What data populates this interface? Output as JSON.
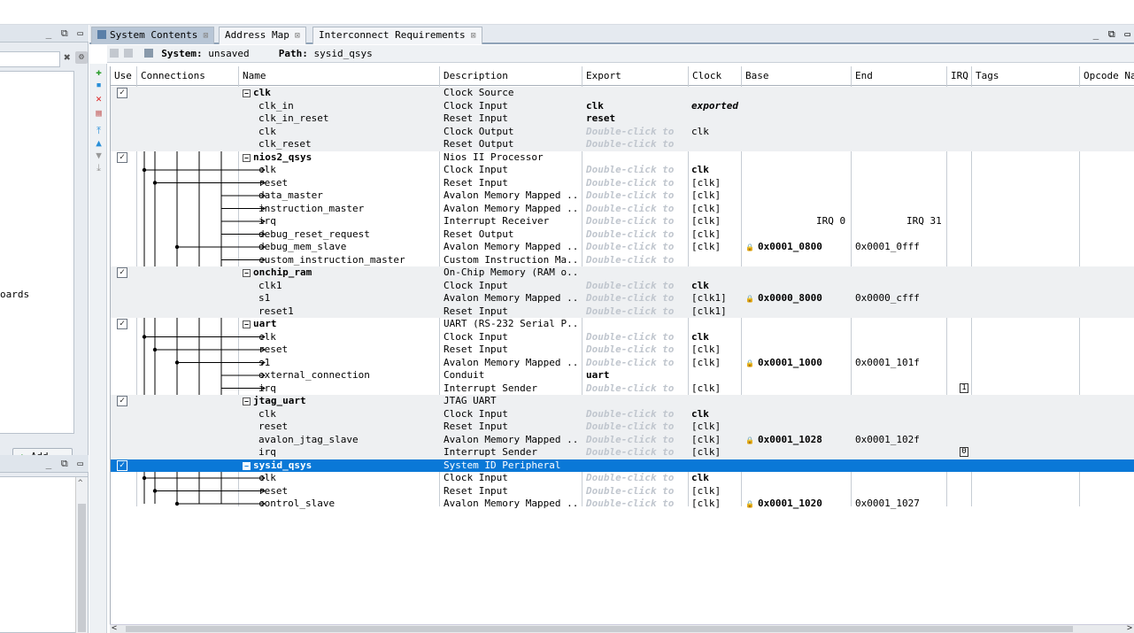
{
  "left_panel": {
    "window_buttons": "_ ⧉ ▭",
    "search_clear": "✖",
    "boards_text": "oards",
    "add_button": "Add...",
    "panel2_window_buttons": "_ ⧉ ▭"
  },
  "tabs": [
    {
      "label": "System Contents",
      "close": "⊠",
      "active": true
    },
    {
      "label": "Address Map",
      "close": "⊠",
      "active": false
    },
    {
      "label": "Interconnect Requirements",
      "close": "⊠",
      "active": false
    }
  ],
  "window_buttons": "_ ⧉ ▭",
  "pathbar": {
    "system_label": "System:",
    "system_value": "unsaved",
    "path_label": "Path:",
    "path_value": "sysid_qsys"
  },
  "columns": [
    "Use",
    "Connections",
    "Name",
    "Description",
    "Export",
    "Clock",
    "Base",
    "End",
    "IRQ",
    "Tags",
    "Opcode Na"
  ],
  "irq_labels": {
    "start": "IRQ 0",
    "end": "IRQ 31"
  },
  "rows": [
    {
      "use": "☑",
      "name": "clk",
      "desc": "Clock Source",
      "export": "",
      "clock": "",
      "base": "",
      "end": "",
      "comp": true
    },
    {
      "name": "clk_in",
      "desc": "Clock Input",
      "export": "clk",
      "clock": "exported",
      "base": "",
      "end": ""
    },
    {
      "name": "clk_in_reset",
      "desc": "Reset Input",
      "export": "reset",
      "clock": "",
      "base": "",
      "end": ""
    },
    {
      "name": "clk",
      "desc": "Clock Output",
      "export": "Double-click to",
      "clock": "clk",
      "base": "",
      "end": ""
    },
    {
      "name": "clk_reset",
      "desc": "Reset Output",
      "export": "Double-click to",
      "clock": "",
      "base": "",
      "end": ""
    },
    {
      "use": "☑",
      "name": "nios2_qsys",
      "desc": "Nios II Processor",
      "export": "",
      "clock": "",
      "base": "",
      "end": "",
      "comp": true
    },
    {
      "name": "clk",
      "desc": "Clock Input",
      "export": "Double-click to",
      "clock": "clk",
      "base": "",
      "end": ""
    },
    {
      "name": "reset",
      "desc": "Reset Input",
      "export": "Double-click to",
      "clock": "[clk]",
      "base": "",
      "end": ""
    },
    {
      "name": "data_master",
      "desc": "Avalon Memory Mapped ...",
      "export": "Double-click to",
      "clock": "[clk]",
      "base": "",
      "end": ""
    },
    {
      "name": "instruction_master",
      "desc": "Avalon Memory Mapped ...",
      "export": "Double-click to",
      "clock": "[clk]",
      "base": "",
      "end": ""
    },
    {
      "name": "irq",
      "desc": "Interrupt Receiver",
      "export": "Double-click to",
      "clock": "[clk]",
      "base": "",
      "end": ""
    },
    {
      "name": "debug_reset_request",
      "desc": "Reset Output",
      "export": "Double-click to",
      "clock": "[clk]",
      "base": "",
      "end": ""
    },
    {
      "name": "debug_mem_slave",
      "desc": "Avalon Memory Mapped ...",
      "export": "Double-click to",
      "clock": "[clk]",
      "base": "0x0001_0800",
      "end": "0x0001_0fff"
    },
    {
      "name": "custom_instruction_master",
      "desc": "Custom Instruction Ma...",
      "export": "Double-click to",
      "clock": "",
      "base": "",
      "end": ""
    },
    {
      "use": "☑",
      "name": "onchip_ram",
      "desc": "On-Chip Memory (RAM o...",
      "export": "",
      "clock": "",
      "base": "",
      "end": "",
      "comp": true
    },
    {
      "name": "clk1",
      "desc": "Clock Input",
      "export": "Double-click to",
      "clock": "clk",
      "base": "",
      "end": ""
    },
    {
      "name": "s1",
      "desc": "Avalon Memory Mapped ...",
      "export": "Double-click to",
      "clock": "[clk1]",
      "base": "0x0000_8000",
      "end": "0x0000_cfff"
    },
    {
      "name": "reset1",
      "desc": "Reset Input",
      "export": "Double-click to",
      "clock": "[clk1]",
      "base": "",
      "end": ""
    },
    {
      "use": "☑",
      "name": "uart",
      "desc": "UART (RS-232 Serial P...",
      "export": "",
      "clock": "",
      "base": "",
      "end": "",
      "comp": true
    },
    {
      "name": "clk",
      "desc": "Clock Input",
      "export": "Double-click to",
      "clock": "clk",
      "base": "",
      "end": ""
    },
    {
      "name": "reset",
      "desc": "Reset Input",
      "export": "Double-click to",
      "clock": "[clk]",
      "base": "",
      "end": ""
    },
    {
      "name": "s1",
      "desc": "Avalon Memory Mapped ...",
      "export": "Double-click to",
      "clock": "[clk]",
      "base": "0x0001_1000",
      "end": "0x0001_101f"
    },
    {
      "name": "external_connection",
      "desc": "Conduit",
      "export": "uart",
      "clock": "",
      "base": "",
      "end": ""
    },
    {
      "name": "irq",
      "desc": "Interrupt Sender",
      "export": "Double-click to",
      "clock": "[clk]",
      "base": "",
      "end": "",
      "irq": "1"
    },
    {
      "use": "☑",
      "name": "jtag_uart",
      "desc": "JTAG UART",
      "export": "",
      "clock": "",
      "base": "",
      "end": "",
      "comp": true
    },
    {
      "name": "clk",
      "desc": "Clock Input",
      "export": "Double-click to",
      "clock": "clk",
      "base": "",
      "end": ""
    },
    {
      "name": "reset",
      "desc": "Reset Input",
      "export": "Double-click to",
      "clock": "[clk]",
      "base": "",
      "end": ""
    },
    {
      "name": "avalon_jtag_slave",
      "desc": "Avalon Memory Mapped ...",
      "export": "Double-click to",
      "clock": "[clk]",
      "base": "0x0001_1028",
      "end": "0x0001_102f"
    },
    {
      "name": "irq",
      "desc": "Interrupt Sender",
      "export": "Double-click to",
      "clock": "[clk]",
      "base": "",
      "end": "",
      "irq": "0"
    },
    {
      "use": "☑",
      "name": "sysid_qsys",
      "desc": "System ID Peripheral",
      "export": "",
      "clock": "",
      "base": "",
      "end": "",
      "comp": true,
      "selected": true
    },
    {
      "name": "clk",
      "desc": "Clock Input",
      "export": "Double-click to",
      "clock": "clk",
      "base": "",
      "end": ""
    },
    {
      "name": "reset",
      "desc": "Reset Input",
      "export": "Double-click to",
      "clock": "[clk]",
      "base": "",
      "end": ""
    },
    {
      "name": "control_slave",
      "desc": "Avalon Memory Mapped ...",
      "export": "Double-click to",
      "clock": "[clk]",
      "base": "0x0001_1020",
      "end": "0x0001_1027"
    }
  ],
  "scroll": {
    "left": "<",
    "right": ">"
  }
}
